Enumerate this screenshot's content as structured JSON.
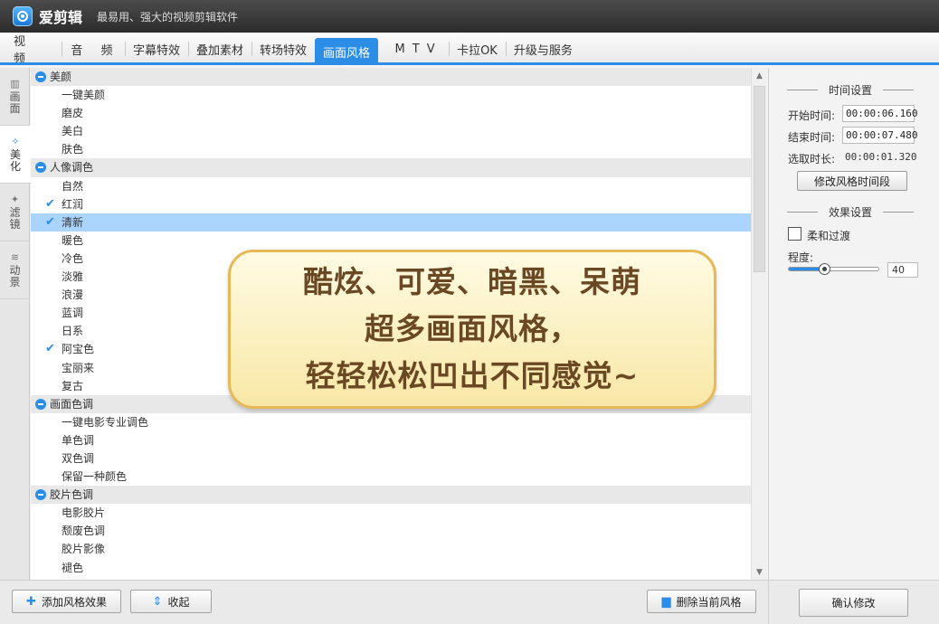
{
  "titlebar": {
    "app_name": "爱剪辑",
    "slogan": "最易用、强大的视频剪辑软件"
  },
  "tabs": [
    {
      "label": "视  频"
    },
    {
      "label": "音  频"
    },
    {
      "label": "字幕特效"
    },
    {
      "label": "叠加素材"
    },
    {
      "label": "转场特效"
    },
    {
      "label": "画面风格",
      "active": true
    },
    {
      "label": "MTV"
    },
    {
      "label": "卡拉OK"
    },
    {
      "label": "升级与服务"
    }
  ],
  "side_tabs": [
    {
      "label": "画面",
      "icon": "film-icon"
    },
    {
      "label": "美化",
      "icon": "magic-wand-icon",
      "active": true
    },
    {
      "label": "滤镜",
      "icon": "filter-wand-icon"
    },
    {
      "label": "动景",
      "icon": "wave-icon"
    }
  ],
  "style_list": {
    "groups": [
      {
        "name": "美颜",
        "items": [
          {
            "label": "一键美颜"
          },
          {
            "label": "磨皮"
          },
          {
            "label": "美白"
          },
          {
            "label": "肤色"
          }
        ]
      },
      {
        "name": "人像调色",
        "items": [
          {
            "label": "自然"
          },
          {
            "label": "红润",
            "checked": true
          },
          {
            "label": "清新",
            "checked": true,
            "selected": true
          },
          {
            "label": "暖色"
          },
          {
            "label": "冷色"
          },
          {
            "label": "淡雅"
          },
          {
            "label": "浪漫"
          },
          {
            "label": "蓝调"
          },
          {
            "label": "日系"
          },
          {
            "label": "阿宝色",
            "checked": true
          },
          {
            "label": "宝丽来"
          },
          {
            "label": "复古"
          }
        ]
      },
      {
        "name": "画面色调",
        "items": [
          {
            "label": "一键电影专业调色"
          },
          {
            "label": "单色调"
          },
          {
            "label": "双色调"
          },
          {
            "label": "保留一种颜色"
          }
        ]
      },
      {
        "name": "胶片色调",
        "items": [
          {
            "label": "电影胶片"
          },
          {
            "label": "颓废色调"
          },
          {
            "label": "胶片影像"
          },
          {
            "label": "褪色"
          }
        ]
      }
    ]
  },
  "banner": {
    "lines": [
      "酷炫、可爱、暗黑、呆萌",
      "超多画面风格，",
      "轻轻松松凹出不同感觉~"
    ]
  },
  "time_settings": {
    "title": "时间设置",
    "start_label": "开始时间:",
    "start_value": "00:00:06.160",
    "end_label": "结束时间:",
    "end_value": "00:00:07.480",
    "duration_label": "选取时长:",
    "duration_value": "00:00:01.320",
    "modify_button": "修改风格时间段"
  },
  "effect_settings": {
    "title": "效果设置",
    "soft_transition_label": "柔和过渡",
    "soft_transition_checked": false,
    "degree_label": "程度:",
    "degree_value": "40",
    "degree_fraction": 0.4
  },
  "bottom": {
    "add_button": "添加风格效果",
    "collapse_button": "收起",
    "delete_button": "删除当前风格",
    "confirm_button": "确认修改"
  },
  "colors": {
    "accent": "#2b8de6",
    "selected_row": "#aad4fb",
    "banner_text": "#6b4824"
  }
}
